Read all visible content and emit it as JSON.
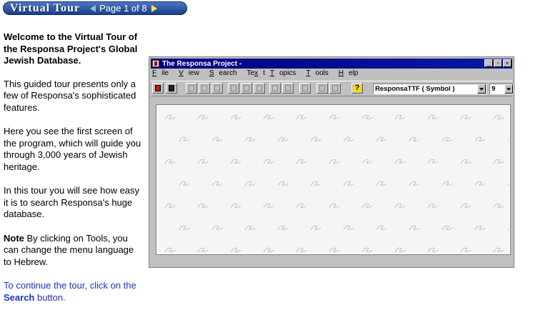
{
  "banner": {
    "title": "Virtual Tour",
    "page_label": "Page 1 of 8"
  },
  "intro": {
    "heading": "Welcome to the Virtual Tour of the Responsa Project's Global Jewish Database.",
    "p2": "This guided tour presents only a few of Responsa's sophisticated features.",
    "p3": "Here you see the first screen of the program, which will guide you through 3,000 years of Jewish heritage.",
    "p4": "In this tour you will see how easy it is to search Responsa's huge database.",
    "note_label": "Note",
    "note_text": " By clicking on Tools, you can change the menu language to Hebrew.",
    "continue_text": "To continue the tour, click on the ",
    "continue_link": "Search",
    "continue_after": " button."
  },
  "app": {
    "title": "The Responsa Project -",
    "window_controls": [
      "_",
      "▫",
      "×"
    ],
    "menu": [
      {
        "u": "F",
        "rest": "ile"
      },
      {
        "u": "V",
        "rest": "iew"
      },
      {
        "u": "S",
        "rest": "earch"
      },
      {
        "u": "T",
        "rest": "ext",
        "pre": "Te",
        "ul_after": true
      },
      {
        "u": "T",
        "rest": "opics"
      },
      {
        "u": "T",
        "rest": "ools"
      },
      {
        "u": "H",
        "rest": "elp"
      }
    ],
    "menu_labels": [
      "File",
      "View",
      "Search",
      "Text",
      "Topics",
      "Tools",
      "Help"
    ],
    "font_combo": "ResponsaTTF ( Symbol )",
    "size_combo": "9",
    "accent": "#00007f",
    "pattern_color": "#c8c8c8"
  }
}
